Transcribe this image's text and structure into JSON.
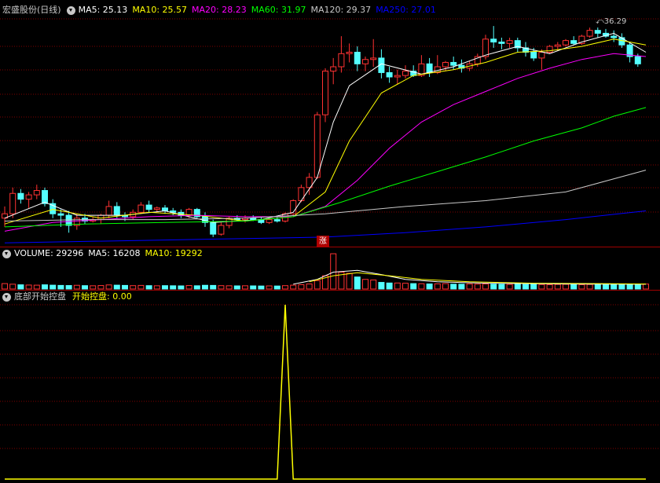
{
  "price_panel": {
    "title": "宏盛股份(日线)",
    "ma_labels": [
      {
        "text": "MA5: 25.13",
        "color": "#ffffff"
      },
      {
        "text": "MA10: 25.57",
        "color": "#ffff00"
      },
      {
        "text": "MA20: 28.23",
        "color": "#ff00ff"
      },
      {
        "text": "MA60: 31.97",
        "color": "#00ff00"
      },
      {
        "text": "MA120: 29.37",
        "color": "#c8c8c8"
      },
      {
        "text": "MA250: 27.01",
        "color": "#0000ff"
      }
    ],
    "peak_label": "36.29",
    "rise_badge": "涨"
  },
  "volume_panel": {
    "labels": [
      {
        "text": "VOLUME: 29296",
        "color": "#ffffff"
      },
      {
        "text": "MA5: 16208",
        "color": "#ffffff"
      },
      {
        "text": "MA10: 19292",
        "color": "#ffff00"
      }
    ]
  },
  "indicator_panel": {
    "title": "底部开始控盘",
    "line_label": "开始控盘: 0.00",
    "title_color": "#c8c8c8",
    "line_color": "#ffff00"
  },
  "colors": {
    "up": "#ff3232",
    "down": "#54ffff",
    "grid": "#800000",
    "ma5": "#ffffff",
    "ma10": "#ffff00",
    "ma20": "#ff00ff",
    "ma60": "#00ff00",
    "ma120": "#c8c8c8",
    "ma250": "#0000ff"
  },
  "chart_data": [
    {
      "type": "candlestick",
      "ylim": [
        22,
        37
      ],
      "candles": [
        {
          "o": 23.2,
          "h": 24.0,
          "l": 22.6,
          "c": 23.5
        },
        {
          "o": 23.5,
          "h": 25.3,
          "l": 23.2,
          "c": 24.9
        },
        {
          "o": 24.9,
          "h": 25.2,
          "l": 24.2,
          "c": 24.5
        },
        {
          "o": 24.5,
          "h": 25.0,
          "l": 23.9,
          "c": 24.8
        },
        {
          "o": 24.8,
          "h": 25.5,
          "l": 24.5,
          "c": 25.1
        },
        {
          "o": 25.1,
          "h": 25.3,
          "l": 24.0,
          "c": 24.2
        },
        {
          "o": 24.2,
          "h": 24.5,
          "l": 23.2,
          "c": 23.5
        },
        {
          "o": 23.5,
          "h": 23.8,
          "l": 22.6,
          "c": 23.4
        },
        {
          "o": 23.4,
          "h": 23.7,
          "l": 22.2,
          "c": 22.7
        },
        {
          "o": 22.7,
          "h": 23.5,
          "l": 22.4,
          "c": 23.2
        },
        {
          "o": 23.2,
          "h": 23.5,
          "l": 22.8,
          "c": 23.0
        },
        {
          "o": 23.0,
          "h": 23.3,
          "l": 22.9,
          "c": 23.1
        },
        {
          "o": 23.1,
          "h": 23.5,
          "l": 22.8,
          "c": 23.4
        },
        {
          "o": 23.4,
          "h": 24.4,
          "l": 23.2,
          "c": 24.0
        },
        {
          "o": 24.0,
          "h": 24.3,
          "l": 23.2,
          "c": 23.4
        },
        {
          "o": 23.4,
          "h": 23.6,
          "l": 23.0,
          "c": 23.3
        },
        {
          "o": 23.3,
          "h": 23.8,
          "l": 23.1,
          "c": 23.6
        },
        {
          "o": 23.6,
          "h": 24.3,
          "l": 23.5,
          "c": 24.1
        },
        {
          "o": 24.1,
          "h": 24.4,
          "l": 23.6,
          "c": 23.8
        },
        {
          "o": 23.8,
          "h": 24.0,
          "l": 23.6,
          "c": 23.9
        },
        {
          "o": 23.9,
          "h": 24.1,
          "l": 23.5,
          "c": 23.7
        },
        {
          "o": 23.7,
          "h": 23.9,
          "l": 23.4,
          "c": 23.6
        },
        {
          "o": 23.6,
          "h": 23.8,
          "l": 23.2,
          "c": 23.4
        },
        {
          "o": 23.4,
          "h": 23.9,
          "l": 23.2,
          "c": 23.8
        },
        {
          "o": 23.8,
          "h": 23.9,
          "l": 23.2,
          "c": 23.3
        },
        {
          "o": 23.3,
          "h": 23.6,
          "l": 22.6,
          "c": 22.9
        },
        {
          "o": 22.9,
          "h": 23.1,
          "l": 21.9,
          "c": 22.1
        },
        {
          "o": 22.1,
          "h": 22.9,
          "l": 22.0,
          "c": 22.7
        },
        {
          "o": 22.7,
          "h": 23.3,
          "l": 22.5,
          "c": 23.2
        },
        {
          "o": 23.2,
          "h": 23.4,
          "l": 23.0,
          "c": 23.1
        },
        {
          "o": 23.1,
          "h": 23.4,
          "l": 22.9,
          "c": 23.2
        },
        {
          "o": 23.2,
          "h": 23.4,
          "l": 23.0,
          "c": 23.1
        },
        {
          "o": 23.1,
          "h": 23.3,
          "l": 22.8,
          "c": 22.9
        },
        {
          "o": 22.9,
          "h": 23.2,
          "l": 22.8,
          "c": 23.1
        },
        {
          "o": 23.1,
          "h": 23.3,
          "l": 22.9,
          "c": 23.0
        },
        {
          "o": 23.0,
          "h": 23.6,
          "l": 22.9,
          "c": 23.5
        },
        {
          "o": 23.5,
          "h": 24.5,
          "l": 23.4,
          "c": 24.4
        },
        {
          "o": 24.4,
          "h": 25.5,
          "l": 24.3,
          "c": 25.3
        },
        {
          "o": 25.3,
          "h": 26.3,
          "l": 24.8,
          "c": 26.0
        },
        {
          "o": 26.0,
          "h": 30.5,
          "l": 25.9,
          "c": 30.3
        },
        {
          "o": 30.3,
          "h": 33.5,
          "l": 29.8,
          "c": 33.3
        },
        {
          "o": 33.3,
          "h": 34.2,
          "l": 32.4,
          "c": 33.6
        },
        {
          "o": 33.6,
          "h": 35.7,
          "l": 33.2,
          "c": 34.5
        },
        {
          "o": 34.5,
          "h": 35.2,
          "l": 33.9,
          "c": 34.6
        },
        {
          "o": 34.6,
          "h": 35.0,
          "l": 33.3,
          "c": 33.8
        },
        {
          "o": 33.8,
          "h": 34.3,
          "l": 33.3,
          "c": 34.1
        },
        {
          "o": 34.1,
          "h": 35.5,
          "l": 33.6,
          "c": 34.2
        },
        {
          "o": 34.2,
          "h": 34.8,
          "l": 32.8,
          "c": 33.2
        },
        {
          "o": 33.2,
          "h": 33.6,
          "l": 32.5,
          "c": 32.9
        },
        {
          "o": 32.9,
          "h": 33.4,
          "l": 32.4,
          "c": 33.0
        },
        {
          "o": 33.0,
          "h": 33.7,
          "l": 32.8,
          "c": 33.3
        },
        {
          "o": 33.3,
          "h": 33.7,
          "l": 32.9,
          "c": 33.0
        },
        {
          "o": 33.0,
          "h": 34.4,
          "l": 32.9,
          "c": 33.8
        },
        {
          "o": 33.8,
          "h": 34.2,
          "l": 32.9,
          "c": 33.2
        },
        {
          "o": 33.2,
          "h": 34.4,
          "l": 33.1,
          "c": 33.6
        },
        {
          "o": 33.6,
          "h": 34.0,
          "l": 33.3,
          "c": 33.9
        },
        {
          "o": 33.9,
          "h": 34.3,
          "l": 33.4,
          "c": 33.7
        },
        {
          "o": 33.7,
          "h": 34.1,
          "l": 33.2,
          "c": 33.5
        },
        {
          "o": 33.5,
          "h": 34.0,
          "l": 33.3,
          "c": 33.8
        },
        {
          "o": 33.8,
          "h": 34.5,
          "l": 33.6,
          "c": 34.3
        },
        {
          "o": 34.3,
          "h": 35.8,
          "l": 34.1,
          "c": 35.5
        },
        {
          "o": 35.5,
          "h": 36.4,
          "l": 34.9,
          "c": 35.3
        },
        {
          "o": 35.3,
          "h": 35.6,
          "l": 34.8,
          "c": 35.2
        },
        {
          "o": 35.2,
          "h": 35.6,
          "l": 34.9,
          "c": 35.4
        },
        {
          "o": 35.4,
          "h": 35.6,
          "l": 34.6,
          "c": 34.9
        },
        {
          "o": 34.9,
          "h": 35.3,
          "l": 34.3,
          "c": 34.6
        },
        {
          "o": 34.6,
          "h": 34.9,
          "l": 34.0,
          "c": 34.2
        },
        {
          "o": 34.2,
          "h": 34.8,
          "l": 33.4,
          "c": 34.6
        },
        {
          "o": 34.6,
          "h": 35.1,
          "l": 34.5,
          "c": 35.0
        },
        {
          "o": 35.0,
          "h": 35.3,
          "l": 34.7,
          "c": 35.1
        },
        {
          "o": 35.1,
          "h": 35.5,
          "l": 35.0,
          "c": 35.4
        },
        {
          "o": 35.4,
          "h": 35.7,
          "l": 35.1,
          "c": 35.2
        },
        {
          "o": 35.2,
          "h": 35.8,
          "l": 35.1,
          "c": 35.7
        },
        {
          "o": 35.7,
          "h": 36.29,
          "l": 35.6,
          "c": 36.1
        },
        {
          "o": 36.1,
          "h": 36.3,
          "l": 35.6,
          "c": 35.9
        },
        {
          "o": 35.9,
          "h": 36.2,
          "l": 35.6,
          "c": 35.7
        },
        {
          "o": 35.7,
          "h": 36.1,
          "l": 35.3,
          "c": 35.6
        },
        {
          "o": 35.6,
          "h": 35.9,
          "l": 34.9,
          "c": 35.1
        },
        {
          "o": 35.1,
          "h": 35.3,
          "l": 33.9,
          "c": 34.3
        },
        {
          "o": 34.3,
          "h": 34.5,
          "l": 33.6,
          "c": 33.8
        }
      ],
      "ma": {
        "ma5": {
          "start": 23.2,
          "points": [
            [
              0,
              23.2
            ],
            [
              5,
              24.3
            ],
            [
              9,
              23.4
            ],
            [
              15,
              23.4
            ],
            [
              20,
              23.7
            ],
            [
              26,
              22.9
            ],
            [
              32,
              23.1
            ],
            [
              36,
              23.6
            ],
            [
              39,
              26.0
            ],
            [
              41,
              29.8
            ],
            [
              43,
              32.3
            ],
            [
              47,
              33.8
            ],
            [
              52,
              33.1
            ],
            [
              56,
              33.6
            ],
            [
              60,
              34.4
            ],
            [
              64,
              35.0
            ],
            [
              68,
              34.5
            ],
            [
              72,
              35.3
            ],
            [
              76,
              35.9
            ],
            [
              80,
              34.6
            ]
          ]
        },
        "ma10": {
          "points": [
            [
              0,
              22.8
            ],
            [
              6,
              23.8
            ],
            [
              12,
              23.2
            ],
            [
              18,
              23.6
            ],
            [
              24,
              23.4
            ],
            [
              30,
              23.0
            ],
            [
              36,
              23.3
            ],
            [
              40,
              25.0
            ],
            [
              43,
              28.5
            ],
            [
              47,
              31.8
            ],
            [
              51,
              33.0
            ],
            [
              56,
              33.4
            ],
            [
              60,
              33.9
            ],
            [
              64,
              34.6
            ],
            [
              68,
              34.7
            ],
            [
              72,
              35.0
            ],
            [
              76,
              35.5
            ],
            [
              80,
              35.1
            ]
          ]
        },
        "ma20": {
          "points": [
            [
              0,
              22.3
            ],
            [
              6,
              22.9
            ],
            [
              12,
              23.1
            ],
            [
              18,
              23.3
            ],
            [
              24,
              23.4
            ],
            [
              30,
              23.3
            ],
            [
              36,
              23.3
            ],
            [
              40,
              24.0
            ],
            [
              44,
              25.8
            ],
            [
              48,
              28.0
            ],
            [
              52,
              29.8
            ],
            [
              56,
              31.0
            ],
            [
              60,
              31.9
            ],
            [
              64,
              32.8
            ],
            [
              68,
              33.5
            ],
            [
              72,
              34.1
            ],
            [
              76,
              34.5
            ],
            [
              80,
              34.3
            ]
          ]
        },
        "ma60": {
          "points": [
            [
              0,
              22.6
            ],
            [
              10,
              22.8
            ],
            [
              20,
              22.9
            ],
            [
              30,
              23.0
            ],
            [
              36,
              23.3
            ],
            [
              42,
              24.3
            ],
            [
              48,
              25.4
            ],
            [
              54,
              26.4
            ],
            [
              60,
              27.4
            ],
            [
              66,
              28.5
            ],
            [
              72,
              29.4
            ],
            [
              76,
              30.2
            ],
            [
              80,
              30.8
            ]
          ]
        },
        "ma120": {
          "points": [
            [
              0,
              23.0
            ],
            [
              10,
              23.1
            ],
            [
              20,
              23.1
            ],
            [
              30,
              23.2
            ],
            [
              40,
              23.5
            ],
            [
              50,
              24.0
            ],
            [
              60,
              24.4
            ],
            [
              70,
              25.0
            ],
            [
              80,
              26.5
            ]
          ]
        },
        "ma250": {
          "points": [
            [
              0,
              21.5
            ],
            [
              10,
              21.6
            ],
            [
              20,
              21.7
            ],
            [
              30,
              21.8
            ],
            [
              40,
              21.9
            ],
            [
              50,
              22.2
            ],
            [
              60,
              22.6
            ],
            [
              70,
              23.1
            ],
            [
              80,
              23.7
            ]
          ]
        }
      }
    },
    {
      "type": "bar",
      "ylim": [
        0,
        30000
      ],
      "volumes": [
        4500,
        4000,
        3500,
        3300,
        3200,
        3500,
        3200,
        3000,
        2900,
        3100,
        2800,
        2700,
        2900,
        3400,
        3200,
        3000,
        2800,
        3000,
        2800,
        2700,
        2800,
        2700,
        2600,
        2900,
        2700,
        3100,
        3000,
        2800,
        2700,
        2600,
        2700,
        2600,
        2500,
        2600,
        2500,
        2800,
        3200,
        3600,
        4200,
        7000,
        11000,
        29296,
        14000,
        13000,
        10000,
        8000,
        7500,
        5500,
        5000,
        5000,
        4800,
        4500,
        4400,
        4200,
        4300,
        4500,
        4000,
        4000,
        4200,
        4000,
        4200,
        4000,
        3900,
        3800,
        4000,
        3800,
        3900,
        3700,
        3600,
        3800,
        3900,
        3700,
        3600,
        3800,
        3700,
        3900,
        3800,
        3900,
        4000,
        3900,
        4100
      ],
      "ma5_points": [
        [
          36,
          4000
        ],
        [
          39,
          8000
        ],
        [
          41,
          14000
        ],
        [
          44,
          15500
        ],
        [
          47,
          12000
        ],
        [
          50,
          8000
        ],
        [
          54,
          6000
        ],
        [
          60,
          4800
        ],
        [
          70,
          4200
        ],
        [
          80,
          4000
        ]
      ],
      "ma10_points": [
        [
          38,
          6000
        ],
        [
          41,
          11000
        ],
        [
          44,
          13500
        ],
        [
          48,
          11000
        ],
        [
          52,
          8000
        ],
        [
          58,
          6000
        ],
        [
          66,
          4800
        ],
        [
          80,
          4200
        ]
      ]
    },
    {
      "type": "line",
      "ylim": [
        0,
        1
      ],
      "values": [
        0,
        0,
        0,
        0,
        0,
        0,
        0,
        0,
        0,
        0,
        0,
        0,
        0,
        0,
        0,
        0,
        0,
        0,
        0,
        0,
        0,
        0,
        0,
        0,
        0,
        0,
        0,
        0,
        0,
        0,
        0,
        0,
        0,
        0,
        0,
        1,
        0,
        0,
        0,
        0,
        0,
        0,
        0,
        0,
        0,
        0,
        0,
        0,
        0,
        0,
        0,
        0,
        0,
        0,
        0,
        0,
        0,
        0,
        0,
        0,
        0,
        0,
        0,
        0,
        0,
        0,
        0,
        0,
        0,
        0,
        0,
        0,
        0,
        0,
        0,
        0,
        0,
        0,
        0,
        0,
        0
      ]
    }
  ]
}
